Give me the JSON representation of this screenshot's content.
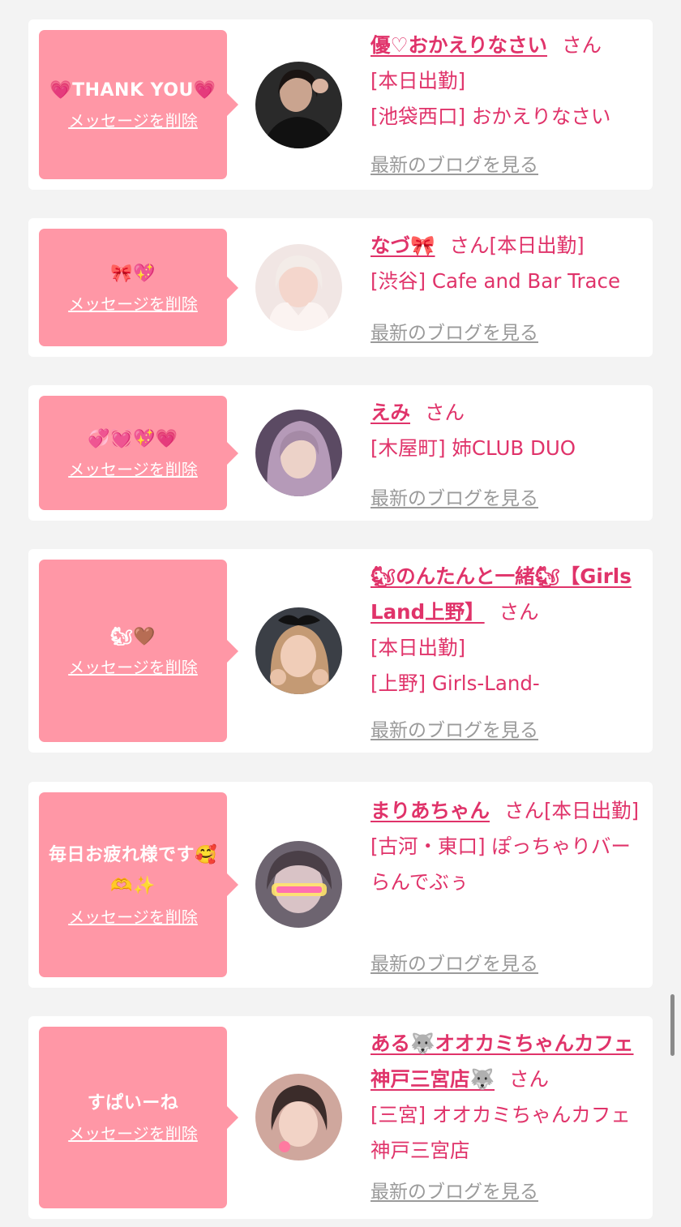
{
  "cards": [
    {
      "message": "💗THANK YOU💗",
      "delete_label": "メッセージを削除",
      "name": "優♡おかえりなさい",
      "suffix": "さん",
      "line1": "[本日出勤]",
      "line2": "[池袋西口] おかえりなさい",
      "blog_label": "最新のブログを見る"
    },
    {
      "message": "🎀💖",
      "delete_label": "メッセージを削除",
      "name": "なづ🎀",
      "suffix": "さん",
      "line1": "[本日出勤]",
      "line2": "[渋谷] Cafe and Bar Trace",
      "blog_label": "最新のブログを見る"
    },
    {
      "message": "💞💓💖💗",
      "delete_label": "メッセージを削除",
      "name": "えみ",
      "suffix": "さん",
      "line1": "[木屋町] 姉CLUB DUO",
      "line2": "",
      "blog_label": "最新のブログを見る"
    },
    {
      "message": "🐿🤎",
      "delete_label": "メッセージを削除",
      "name": "🐿のんたんと一緒🐿【Girls Land上野】",
      "suffix": "さん",
      "line1": "[本日出勤]",
      "line2": "[上野] Girls-Land-",
      "blog_label": "最新のブログを見る"
    },
    {
      "message": "毎日お疲れ様です🥰🫶✨",
      "delete_label": "メッセージを削除",
      "name": "まりあちゃん",
      "suffix": "さん",
      "line1": "[本日出勤]",
      "line2": "[古河・東口] ぽっちゃりバー らんでぶぅ",
      "blog_label": "最新のブログを見る"
    },
    {
      "message": "すぱいーね",
      "delete_label": "メッセージを削除",
      "name": "ある🐺オオカミちゃんカフェ神戸三宮店🐺",
      "suffix": "さん",
      "line1": "[三宮] オオカミちゃんカフェ神戸三宮店",
      "line2": "",
      "blog_label": "最新のブログを見る"
    }
  ],
  "colors": {
    "accent": "#e0336a",
    "bubble": "#ff97a6",
    "muted": "#9a9a9a"
  }
}
